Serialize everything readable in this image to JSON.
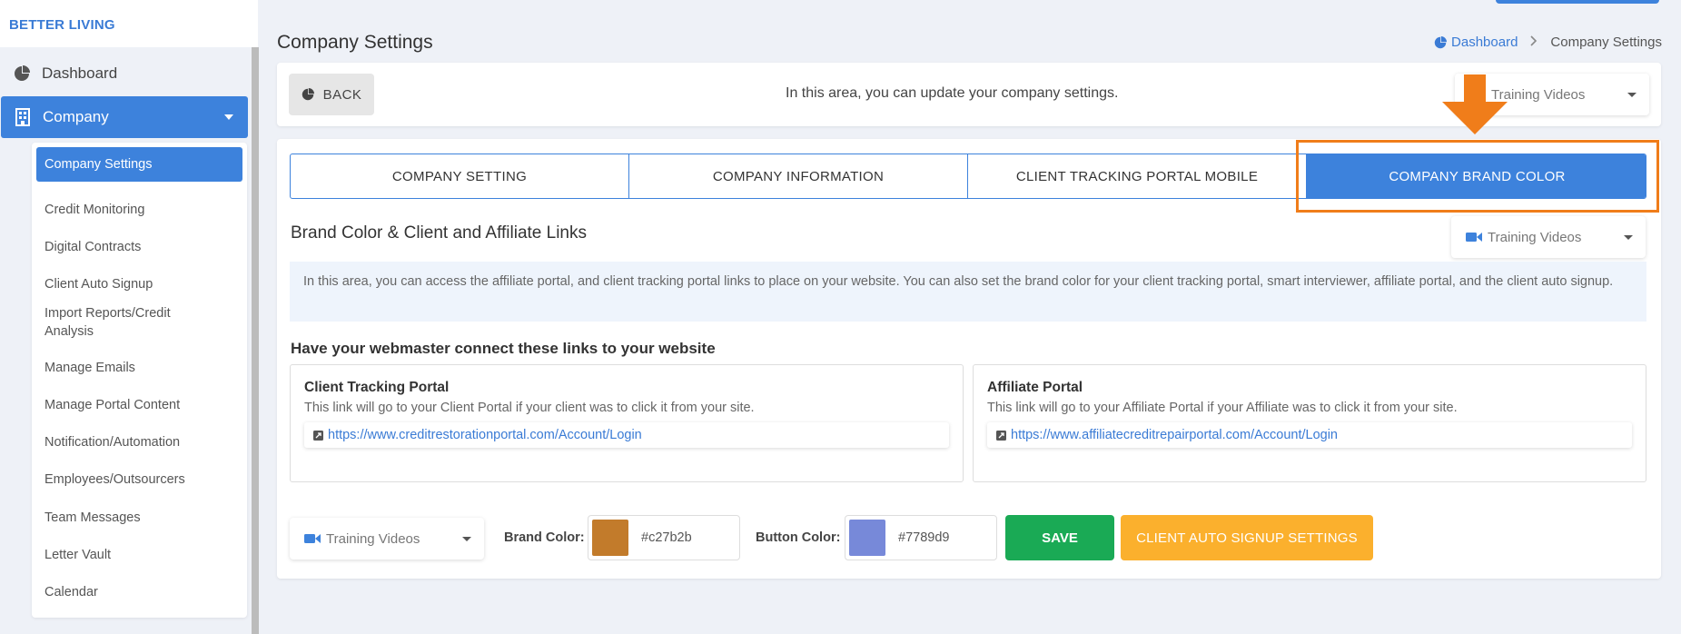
{
  "brand": "BETTER LIVING",
  "sidebar": {
    "dashboard_label": "Dashboard",
    "company_label": "Company",
    "submenu": [
      "Company Settings",
      "Credit Monitoring",
      "Digital Contracts",
      "Client Auto Signup",
      "Import Reports/Credit Analysis",
      "Manage Emails",
      "Manage Portal Content",
      "Notification/Automation",
      "Employees/Outsourcers",
      "Team Messages",
      "Letter Vault",
      "Calendar"
    ]
  },
  "header": {
    "title": "Company Settings",
    "breadcrumb_link": "Dashboard",
    "breadcrumb_current": "Company Settings"
  },
  "top_card": {
    "back_label": "BACK",
    "description": "In this area, you can update your company settings.",
    "training_videos_label": "Training Videos"
  },
  "tabs": [
    {
      "label": "COMPANY SETTING",
      "active": false
    },
    {
      "label": "COMPANY INFORMATION",
      "active": false
    },
    {
      "label": "CLIENT TRACKING PORTAL MOBILE",
      "active": false
    },
    {
      "label": "COMPANY BRAND COLOR",
      "active": true
    }
  ],
  "brand_section": {
    "title": "Brand Color & Client and Affiliate Links",
    "training_videos_label": "Training Videos",
    "info_text": "In this area, you can access the affiliate portal, and client tracking portal links to place on your website. You can also set the brand color for your client tracking portal, smart interviewer, affiliate portal, and the client auto signup.",
    "links_heading": "Have your webmaster connect these links to your website",
    "client_portal": {
      "title": "Client Tracking Portal",
      "description": "This link will go to your Client Portal if your client was to click it from your site.",
      "url": "https://www.creditrestorationportal.com/Account/Login"
    },
    "affiliate_portal": {
      "title": "Affiliate Portal",
      "description": "This link will go to your Affiliate Portal if your Affiliate was to click it from your site.",
      "url": "https://www.affiliatecreditrepairportal.com/Account/Login"
    },
    "bottom_training_videos_label": "Training Videos",
    "brand_color_label": "Brand Color:",
    "brand_color_value": "#c27b2b",
    "button_color_label": "Button Color:",
    "button_color_value": "#7789d9",
    "save_label": "SAVE",
    "client_auto_signup_label": "CLIENT AUTO SIGNUP SETTINGS"
  },
  "colors": {
    "primary": "#3d82dc",
    "highlight": "#f07d1a",
    "save": "#1aaa55",
    "auto_signup": "#fbb02d"
  }
}
